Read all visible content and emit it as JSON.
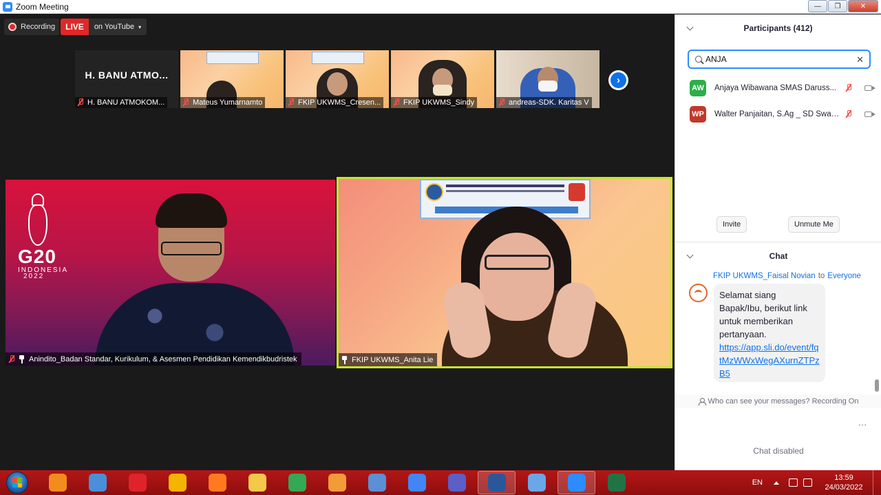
{
  "window": {
    "title": "Zoom Meeting",
    "controls": {
      "minimize": "—",
      "maximize": "❐",
      "close": "✕"
    }
  },
  "recording": {
    "label": "Recording",
    "live_badge": "LIVE",
    "destination": "on YouTube",
    "caret": "▾"
  },
  "gallery_strip": [
    {
      "big_name": "H. BANU ATMO...",
      "name": "H. BANU ATMOKOM...",
      "muted": true,
      "kind": "name-only"
    },
    {
      "name": "Mateus Yumarnamto",
      "muted": true,
      "kind": "slide"
    },
    {
      "name": "FKIP UKWMS_Cresen...",
      "muted": true,
      "kind": "slide-person"
    },
    {
      "name": "FKIP UKWMS_Sindy",
      "muted": true,
      "kind": "masked"
    },
    {
      "name": "andreas-SDK. Karitas V",
      "muted": true,
      "kind": "room"
    }
  ],
  "next_arrow": "›",
  "main_tiles": {
    "left": {
      "name": "Anindito_Badan Standar, Kurikulum, & Asesmen Pendidikan Kemendikbudristek",
      "muted": true,
      "pinned": true,
      "background_logo": {
        "text": "G20",
        "line1": "INDONESIA",
        "line2": "2022"
      }
    },
    "right": {
      "name": "FKIP UKWMS_Anita Lie",
      "pinned": true,
      "active_speaker": true
    }
  },
  "participants": {
    "title": "Participants (412)",
    "search_value": "ANJA",
    "search_clear": "✕",
    "list": [
      {
        "initials": "AW",
        "name": "Anjaya Wibawana SMAS Daruss...",
        "color": "#2eae4a",
        "muted": true
      },
      {
        "initials": "WP",
        "name": "Walter Panjaitan, S.Ag _ SD Swas...",
        "color": "#c0392b",
        "muted": true
      }
    ],
    "invite_label": "Invite",
    "unmute_me_label": "Unmute Me"
  },
  "chat": {
    "title": "Chat",
    "message": {
      "sender": "FKIP UKWMS_Faisal Novian",
      "to_word": "to",
      "recipient": "Everyone",
      "text": "Selamat siang Bapak/Ibu, berikut link untuk memberikan pertanyaan.",
      "link": "https://app.sli.do/event/fqtMzWWxWegAXurnZTPzB5"
    },
    "who_can_see": "Who can see your messages? Recording On",
    "more": "...",
    "status": "Chat disabled"
  },
  "taskbar": {
    "apps": [
      {
        "name": "firefox-like-browser",
        "color": "#f28c1e",
        "active": false
      },
      {
        "name": "network-manager",
        "color": "#4a90d9",
        "active": false
      },
      {
        "name": "opera",
        "color": "#e0232b",
        "active": false
      },
      {
        "name": "browser",
        "color": "#f5b400",
        "active": false
      },
      {
        "name": "firefox",
        "color": "#ff7a1f",
        "active": false
      },
      {
        "name": "file-explorer",
        "color": "#f3c94a",
        "active": false
      },
      {
        "name": "chrome",
        "color": "#34a853",
        "active": false
      },
      {
        "name": "media-player",
        "color": "#f29b38",
        "active": false
      },
      {
        "name": "keyboard-tool",
        "color": "#5b8fd6",
        "active": false
      },
      {
        "name": "chrome",
        "color": "#4285f4",
        "active": false
      },
      {
        "name": "teams",
        "color": "#5b5fc7",
        "active": false
      },
      {
        "name": "word",
        "color": "#2b579a",
        "active": true
      },
      {
        "name": "photo-viewer",
        "color": "#6aa6e8",
        "active": false
      },
      {
        "name": "zoom",
        "color": "#2d8cff",
        "active": true
      },
      {
        "name": "excel",
        "color": "#217346",
        "active": false
      }
    ],
    "language": "EN",
    "time": "13:59",
    "date": "24/03/2022"
  }
}
